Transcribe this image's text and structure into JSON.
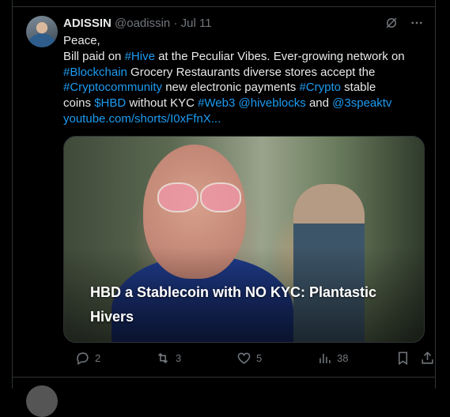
{
  "tweet": {
    "display_name": "ADISSIN",
    "handle": "@oadissin",
    "separator": "·",
    "date": "Jul 11",
    "lines": [
      [
        {
          "t": "Peace,",
          "c": "text"
        }
      ],
      [
        {
          "t": "Bill paid on ",
          "c": "text"
        },
        {
          "t": "#Hive",
          "c": "link"
        },
        {
          "t": " at the Peculiar Vibes. Ever-growing network on",
          "c": "text"
        }
      ],
      [
        {
          "t": "#Blockchain",
          "c": "link"
        },
        {
          "t": " Grocery Restaurants diverse stores accept the",
          "c": "text"
        }
      ],
      [
        {
          "t": "#Cryptocommunity",
          "c": "link"
        },
        {
          "t": " new electronic payments ",
          "c": "text"
        },
        {
          "t": "#Crypto",
          "c": "link"
        },
        {
          "t": " stable",
          "c": "text"
        }
      ],
      [
        {
          "t": "coins ",
          "c": "text"
        },
        {
          "t": "$HBD",
          "c": "link"
        },
        {
          "t": " without KYC ",
          "c": "text"
        },
        {
          "t": "#Web3",
          "c": "link"
        },
        {
          "t": " ",
          "c": "text"
        },
        {
          "t": "@hiveblocks",
          "c": "link"
        },
        {
          "t": " and ",
          "c": "text"
        },
        {
          "t": "@3speaktv",
          "c": "link"
        }
      ],
      [
        {
          "t": "youtube.com/shorts/I0xFfnX...",
          "c": "link"
        }
      ]
    ],
    "media_caption": "HBD a Stablecoin with NO KYC: Plantastic Hivers",
    "stats": {
      "replies": "2",
      "reposts": "3",
      "likes": "5",
      "views": "38"
    }
  },
  "colors": {
    "background": "#000000",
    "text": "#e7e9ea",
    "muted": "#71767b",
    "link": "#1d9bf0",
    "border": "#2f3336"
  },
  "icons": [
    "grok-icon",
    "more-icon",
    "reply-icon",
    "repost-icon",
    "like-icon",
    "views-icon",
    "bookmark-icon",
    "share-icon"
  ]
}
